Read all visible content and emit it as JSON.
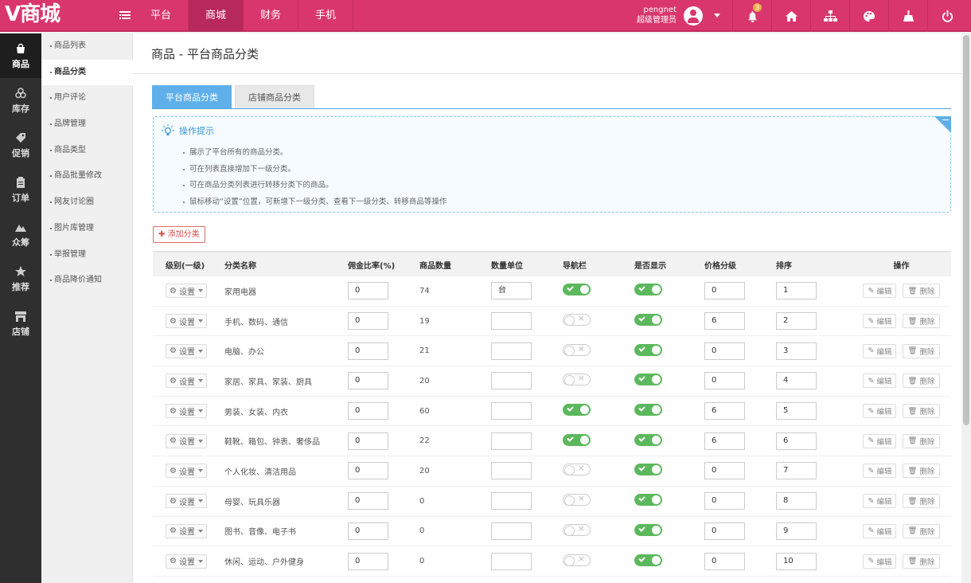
{
  "brand": {
    "logo": "V商城",
    "accent": "#d9366d"
  },
  "topnav": {
    "items": [
      {
        "label": "平台",
        "active": false
      },
      {
        "label": "商城",
        "active": true
      },
      {
        "label": "财务",
        "active": false
      },
      {
        "label": "手机",
        "active": false
      }
    ]
  },
  "user": {
    "name": "pengnet",
    "role": "超级管理员"
  },
  "notifications": {
    "count": "3"
  },
  "sidebar": {
    "items": [
      {
        "label": "商品",
        "icon": "shopping-bag-icon",
        "active": true
      },
      {
        "label": "库存",
        "icon": "cubes-icon",
        "active": false
      },
      {
        "label": "促销",
        "icon": "tag-icon",
        "active": false
      },
      {
        "label": "订单",
        "icon": "clipboard-icon",
        "active": false
      },
      {
        "label": "众筹",
        "icon": "mountain-icon",
        "active": false
      },
      {
        "label": "推荐",
        "icon": "star-icon",
        "active": false
      },
      {
        "label": "店铺",
        "icon": "store-icon",
        "active": false
      }
    ]
  },
  "subnav": {
    "items": [
      {
        "label": "商品列表",
        "active": false
      },
      {
        "label": "商品分类",
        "active": true
      },
      {
        "label": "用户评论",
        "active": false
      },
      {
        "label": "品牌管理",
        "active": false
      },
      {
        "label": "商品类型",
        "active": false
      },
      {
        "label": "商品批量修改",
        "active": false
      },
      {
        "label": "网友讨论圈",
        "active": false
      },
      {
        "label": "图片库管理",
        "active": false
      },
      {
        "label": "举报管理",
        "active": false
      },
      {
        "label": "商品降价通知",
        "active": false
      }
    ]
  },
  "page": {
    "title": "商品 - 平台商品分类"
  },
  "tabs": [
    {
      "label": "平台商品分类",
      "active": true
    },
    {
      "label": "店铺商品分类",
      "active": false
    }
  ],
  "tips": {
    "title": "操作提示",
    "items": [
      "展示了平台所有的商品分类。",
      "可在列表直接增加下一级分类。",
      "可在商品分类列表进行转移分类下的商品。",
      "鼠标移动“设置”位置，可新增下一级分类、查看下一级分类、转移商品等操作"
    ]
  },
  "add_button": "添加分类",
  "table": {
    "headers": [
      "级别(一级)",
      "分类名称",
      "佣金比率(%)",
      "商品数量",
      "数量单位",
      "导航栏",
      "是否显示",
      "价格分级",
      "排序",
      "操作"
    ],
    "set_label": "设置",
    "edit_label": "编辑",
    "delete_label": "删除",
    "rows": [
      {
        "name": "家用电器",
        "commission": "0",
        "count": "74",
        "unit": "台",
        "nav": true,
        "show": true,
        "price_grade": "0",
        "sort": "1"
      },
      {
        "name": "手机、数码、通信",
        "commission": "0",
        "count": "19",
        "unit": "",
        "nav": false,
        "show": true,
        "price_grade": "6",
        "sort": "2"
      },
      {
        "name": "电脑、办公",
        "commission": "0",
        "count": "21",
        "unit": "",
        "nav": false,
        "show": true,
        "price_grade": "0",
        "sort": "3"
      },
      {
        "name": "家居、家具、家装、厨具",
        "commission": "0",
        "count": "20",
        "unit": "",
        "nav": false,
        "show": true,
        "price_grade": "0",
        "sort": "4"
      },
      {
        "name": "男装、女装、内衣",
        "commission": "0",
        "count": "60",
        "unit": "",
        "nav": true,
        "show": true,
        "price_grade": "6",
        "sort": "5"
      },
      {
        "name": "鞋靴、箱包、钟表、奢侈品",
        "commission": "0",
        "count": "22",
        "unit": "",
        "nav": true,
        "show": true,
        "price_grade": "6",
        "sort": "6"
      },
      {
        "name": "个人化妆、清洁用品",
        "commission": "0",
        "count": "20",
        "unit": "",
        "nav": false,
        "show": true,
        "price_grade": "0",
        "sort": "7"
      },
      {
        "name": "母婴、玩具乐器",
        "commission": "0",
        "count": "0",
        "unit": "",
        "nav": false,
        "show": true,
        "price_grade": "0",
        "sort": "8"
      },
      {
        "name": "图书、音像、电子书",
        "commission": "0",
        "count": "0",
        "unit": "",
        "nav": false,
        "show": true,
        "price_grade": "0",
        "sort": "9"
      },
      {
        "name": "休闲、运动、户外健身",
        "commission": "0",
        "count": "0",
        "unit": "",
        "nav": false,
        "show": true,
        "price_grade": "0",
        "sort": "10"
      }
    ]
  }
}
